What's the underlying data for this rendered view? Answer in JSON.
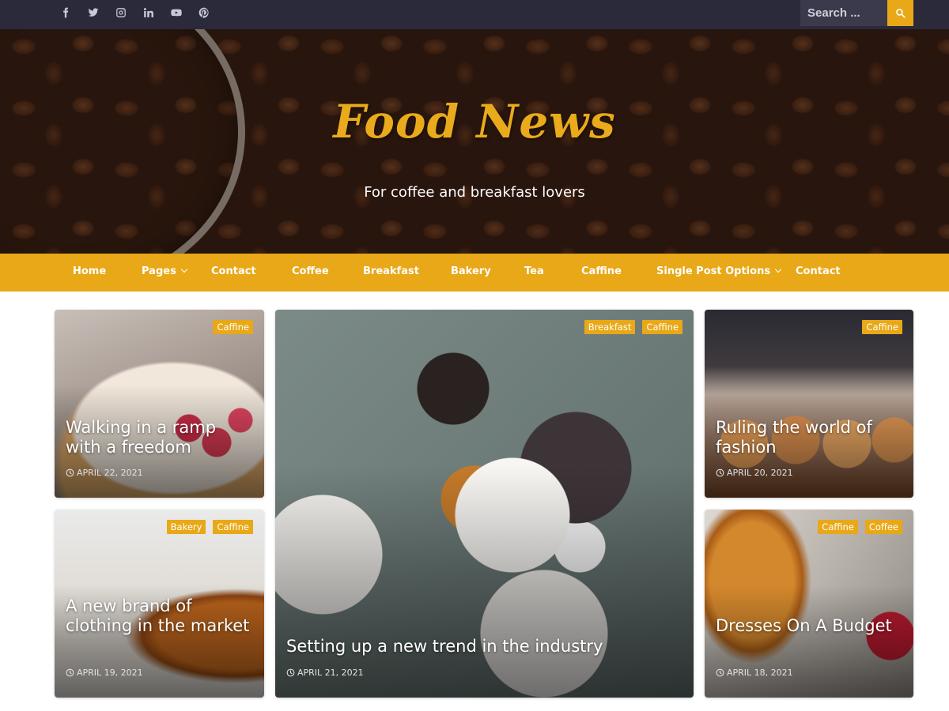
{
  "topbar": {
    "social_icons": [
      "facebook-icon",
      "twitter-icon",
      "instagram-icon",
      "linkedin-icon",
      "youtube-icon",
      "pinterest-icon"
    ],
    "search": {
      "placeholder": "Search ...",
      "button_icon": "search-icon"
    }
  },
  "hero": {
    "title": "Food News",
    "tagline": "For coffee and breakfast lovers"
  },
  "nav": {
    "items": [
      {
        "label": "Home"
      },
      {
        "label": "Pages",
        "has_dropdown": true
      },
      {
        "label": "Contact"
      },
      {
        "label": "Coffee"
      },
      {
        "label": "Breakfast"
      },
      {
        "label": "Bakery"
      },
      {
        "label": "Tea"
      },
      {
        "label": "Caffine"
      },
      {
        "label": "Single Post Options",
        "has_dropdown": true
      },
      {
        "label": "Contact"
      }
    ]
  },
  "posts": [
    {
      "title": "Walking in a ramp with a freedom",
      "date": "APRIL 22, 2021",
      "tags": [
        "Caffine"
      ]
    },
    {
      "title": "A new brand of clothing in the market",
      "date": "APRIL 19, 2021",
      "tags": [
        "Bakery",
        "Caffine"
      ]
    },
    {
      "title": "Setting up a new trend in the industry",
      "date": "APRIL 21, 2021",
      "tags": [
        "Breakfast",
        "Caffine"
      ]
    },
    {
      "title": "Ruling the world of fashion",
      "date": "APRIL 20, 2021",
      "tags": [
        "Caffine"
      ]
    },
    {
      "title": "Dresses On A Budget",
      "date": "APRIL 18, 2021",
      "tags": [
        "Caffine",
        "Coffee"
      ]
    }
  ],
  "colors": {
    "accent": "#e8a817",
    "topbar": "#2b2a3b",
    "title": "#e9ab1c"
  }
}
